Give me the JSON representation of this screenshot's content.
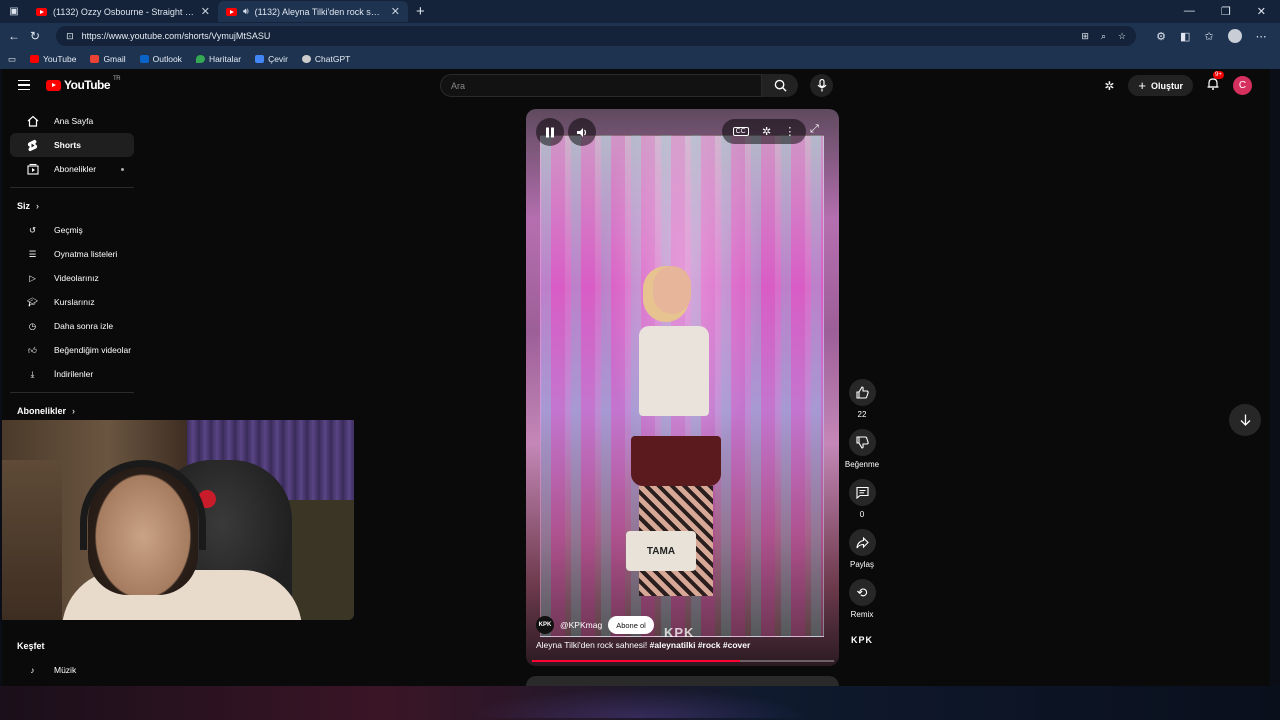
{
  "browser": {
    "tabs": [
      {
        "title": "(1132) Ozzy Osbourne - Straight to Hell",
        "active": false
      },
      {
        "title": "(1132) Aleyna Tilki'den rock sahnesi!",
        "active": true
      }
    ],
    "url": "https://www.youtube.com/shorts/VymujMtSASU",
    "bookmarks": [
      "YouTube",
      "Gmail",
      "Outlook",
      "Haritalar",
      "Çevir",
      "ChatGPT"
    ]
  },
  "youtube": {
    "logo_text": "YouTube",
    "logo_region": "TR",
    "search_placeholder": "Ara",
    "create_label": "Oluştur",
    "notif_badge": "9+",
    "avatar_letter": "C",
    "sidebar": {
      "primary": [
        "Ana Sayfa",
        "Shorts",
        "Abonelikler"
      ],
      "you_header": "Siz",
      "you_items": [
        "Geçmiş",
        "Oynatma listeleri",
        "Videolarınız",
        "Kurslarınız",
        "Daha sonra izle",
        "Beğendiğim videolar",
        "İndirilenler"
      ],
      "subs_header": "Abonelikler",
      "explore_header": "Keşfet",
      "explore_items": [
        "Müzik"
      ]
    },
    "short": {
      "channel_avatar": "KPK",
      "channel_handle": "@KPKmag",
      "subscribe_label": "Abone ol",
      "caption_plain": "Aleyna Tilki'den rock sahnesi!",
      "caption_tags": "#aleynatilki #rock #cover",
      "watermark": "KPK",
      "drum_text": "TAMA",
      "progress": 0.69
    },
    "actions": {
      "like_count": "22",
      "dislike_label": "Beğenme",
      "comment_count": "0",
      "share_label": "Paylaş",
      "remix_label": "Remix",
      "channel_mark": "KPK"
    }
  },
  "colors": {
    "accent_red": "#ff0033",
    "bg": "#0a0a0a",
    "chrome": "#1e3350"
  }
}
